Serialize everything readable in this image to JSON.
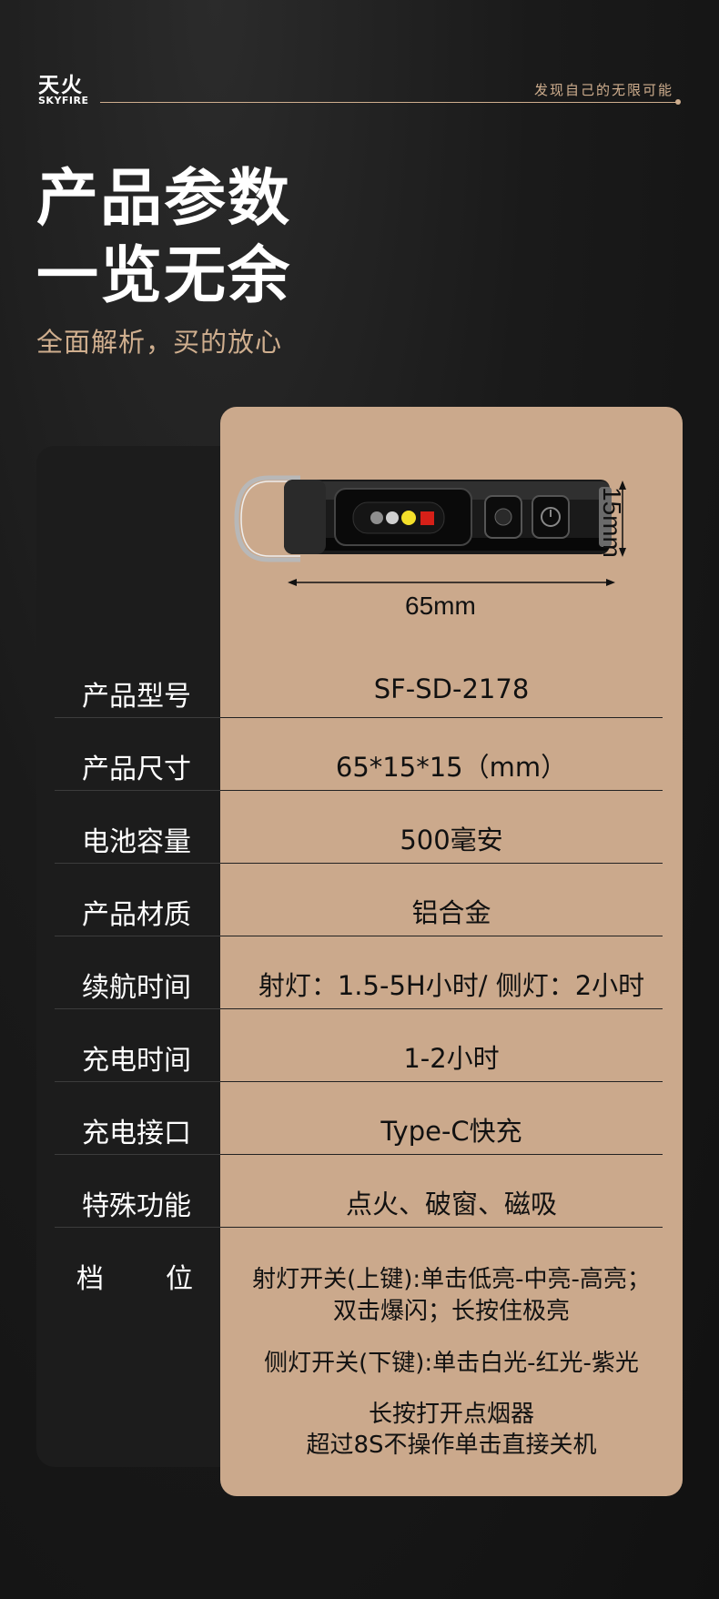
{
  "brand": {
    "name_cn": "天火",
    "name_en": "SKYFIRE",
    "slogan": "发现自己的无限可能"
  },
  "header": {
    "title_line1": "产品参数",
    "title_line2": "一览无余",
    "subtitle": "全面解析，买的放心"
  },
  "product_image": {
    "width_label": "65mm",
    "height_label": "15mm"
  },
  "specs": [
    {
      "label": "产品型号",
      "value": "SF-SD-2178"
    },
    {
      "label": "产品尺寸",
      "value": "65*15*15（mm）"
    },
    {
      "label": "电池容量",
      "value": "500毫安"
    },
    {
      "label": "产品材质",
      "value": "铝合金"
    },
    {
      "label": "续航时间",
      "value": "射灯：1.5-5H小时/ 侧灯：2小时"
    },
    {
      "label": "充电时间",
      "value": "1-2小时"
    },
    {
      "label": "充电接口",
      "value": "Type-C快充"
    },
    {
      "label": "特殊功能",
      "value": "点火、破窗、磁吸"
    }
  ],
  "modes": {
    "label_left": "档",
    "label_right": "位",
    "lines": [
      "射灯开关(上键):单击低亮-中亮-高亮；",
      "双击爆闪；长按住极亮",
      "侧灯开关(下键):单击白光-红光-紫光",
      "长按打开点烟器",
      "超过8S不操作单击直接关机"
    ]
  },
  "colors": {
    "accent": "#cfae8e",
    "panel_tan": "#cba98c",
    "background": "#151515"
  }
}
